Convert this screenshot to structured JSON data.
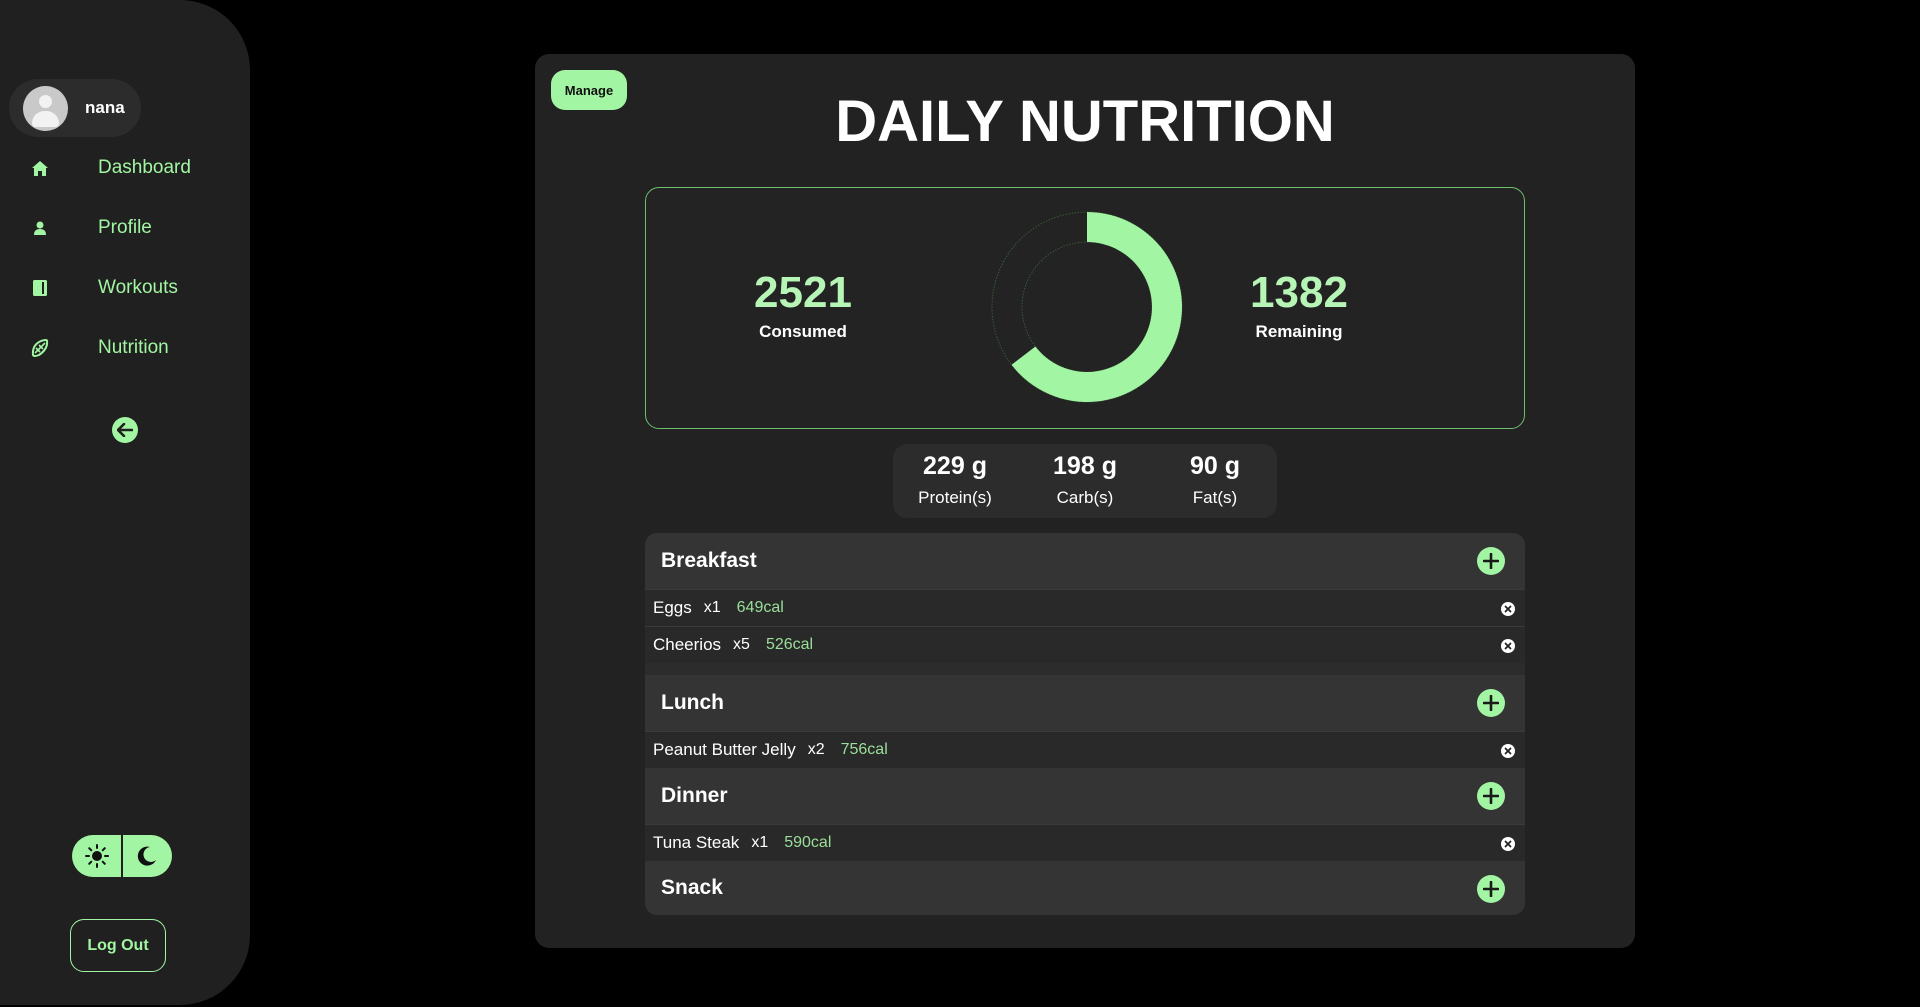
{
  "user": {
    "name": "nana"
  },
  "sidebar": {
    "items": [
      {
        "label": "Dashboard",
        "icon": "home-icon"
      },
      {
        "label": "Profile",
        "icon": "person-icon"
      },
      {
        "label": "Workouts",
        "icon": "book-icon"
      },
      {
        "label": "Nutrition",
        "icon": "nutrition-icon"
      }
    ],
    "logout_label": "Log Out"
  },
  "colors": {
    "accent": "#a2f5a2",
    "sidebar_bg": "#1f201f",
    "card_bg": "#212221"
  },
  "main": {
    "manage_label": "Manage",
    "title": "DAILY NUTRITION",
    "consumed": {
      "value": "2521",
      "label": "Consumed"
    },
    "remaining": {
      "value": "1382",
      "label": "Remaining"
    },
    "ring_fraction": 0.646,
    "macros": [
      {
        "amount": "229 g",
        "label": "Protein(s)"
      },
      {
        "amount": "198 g",
        "label": "Carb(s)"
      },
      {
        "amount": "90 g",
        "label": "Fat(s)"
      }
    ],
    "meals": [
      {
        "name": "Breakfast",
        "items": [
          {
            "name": "Eggs",
            "qty": "x1",
            "cal": "649cal"
          },
          {
            "name": "Cheerios",
            "qty": "x5",
            "cal": "526cal"
          }
        ]
      },
      {
        "name": "Lunch",
        "items": [
          {
            "name": "Peanut Butter Jelly",
            "qty": "x2",
            "cal": "756cal"
          }
        ]
      },
      {
        "name": "Dinner",
        "items": [
          {
            "name": "Tuna Steak",
            "qty": "x1",
            "cal": "590cal"
          }
        ]
      },
      {
        "name": "Snack",
        "items": []
      }
    ]
  }
}
